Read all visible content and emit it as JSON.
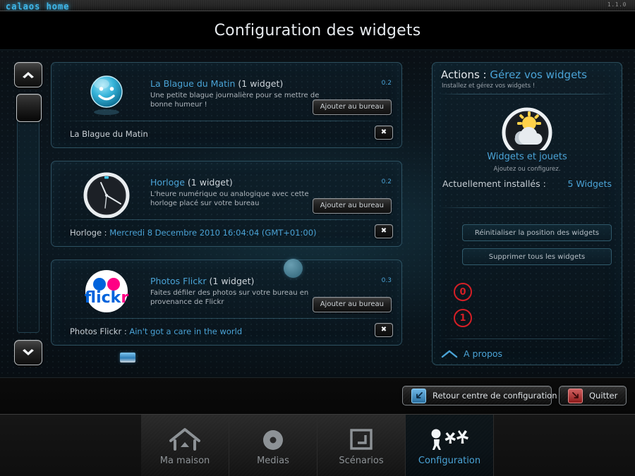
{
  "titlebar": {
    "logo": "calaos home",
    "version": "1.1.0"
  },
  "header": {
    "title": "Configuration des widgets"
  },
  "scrollbar": {
    "up_icon": "chevron-up-icon",
    "down_icon": "chevron-down-icon"
  },
  "widgets": [
    {
      "icon": "smiley-face-icon",
      "name": "La Blague du Matin",
      "count": "(1 widget)",
      "description": "Une petite blague journalière pour se mettre de bonne humeur !",
      "version": "0.2",
      "add_label": "Ajouter au bureau",
      "instance_label": "La Blague du Matin",
      "instance_value": "",
      "remove_icon": "✖"
    },
    {
      "icon": "clock-icon",
      "name": "Horloge",
      "count": "(1 widget)",
      "description": "L'heure numérique ou analogique avec cette horloge placé sur votre bureau",
      "version": "0.2",
      "add_label": "Ajouter au bureau",
      "instance_label": "Horloge : ",
      "instance_value": "Mercredi 8 Decembre 2010 16:04:04 (GMT+01:00)",
      "remove_icon": "✖"
    },
    {
      "icon": "flickr-logo-icon",
      "name": "Photos Flickr",
      "count": "(1 widget)",
      "description": "Faites défiler des photos sur votre bureau en provenance de Flickr",
      "version": "0.3",
      "add_label": "Ajouter au bureau",
      "instance_label": "Photos Flickr : ",
      "instance_value": "Ain't got a care in the world",
      "remove_icon": "✖"
    }
  ],
  "actions": {
    "title_prefix": "Actions : ",
    "title_value": "Gérez vos widgets",
    "subtitle": "Installez et gérez vos widgets !",
    "hero_icon": "sun-cloud-widget-icon",
    "hero_title": "Widgets et jouets",
    "hero_subtitle": "Ajoutez ou configurez.",
    "installed_label": "Actuellement installés :",
    "installed_value": "5 Widgets",
    "buttons": [
      {
        "marker": "0",
        "label": "Réinitialiser la position des widgets"
      },
      {
        "marker": "1",
        "label": "Supprimer tous les widgets"
      }
    ],
    "about_icon": "chevron-up-icon",
    "about_label": "A propos"
  },
  "footer": {
    "back_icon": "arrow-down-left-icon",
    "back_label": "Retour centre de configuration",
    "quit_icon": "arrow-down-right-icon",
    "quit_label": "Quitter"
  },
  "nav": {
    "items": [
      {
        "icon": "house-icon",
        "label": "Ma maison",
        "active": false
      },
      {
        "icon": "disc-icon",
        "label": "Medias",
        "active": false
      },
      {
        "icon": "spiral-icon",
        "label": "Scénarios",
        "active": false
      },
      {
        "icon": "gears-people-icon",
        "label": "Configuration",
        "active": true
      }
    ]
  },
  "colors": {
    "accent_blue": "#4aa3d6",
    "panel_border": "#5ca0b9",
    "marker_red": "#d61f26",
    "text_primary": "#d8dde1"
  }
}
